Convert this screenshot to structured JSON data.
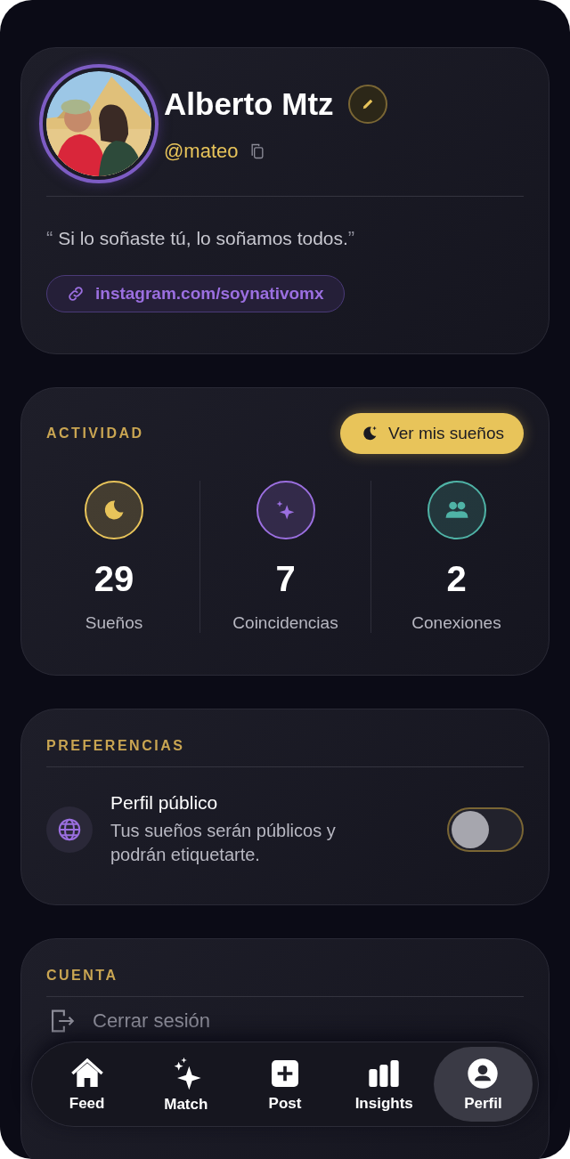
{
  "profile": {
    "name": "Alberto Mtz",
    "handle": "@mateo",
    "quote_open": "“",
    "quote": "Si lo soñaste tú, lo soñamos todos.",
    "quote_close": "”",
    "link": "instagram.com/soynativomx"
  },
  "activity": {
    "title": "ACTIVIDAD",
    "button": "Ver mis sueños",
    "stats": [
      {
        "kind": "moon",
        "value": "29",
        "label": "Sueños",
        "color": "#e8c45a"
      },
      {
        "kind": "sparkles",
        "value": "7",
        "label": "Coincidencias",
        "color": "#9b6fe0"
      },
      {
        "kind": "people",
        "value": "2",
        "label": "Conexiones",
        "color": "#4fb3a6"
      }
    ]
  },
  "preferences": {
    "title": "PREFERENCIAS",
    "items": [
      {
        "title": "Perfil público",
        "description": "Tus sueños serán públicos y podrán etiquetarte.",
        "on": false
      }
    ]
  },
  "account": {
    "title": "CUENTA",
    "items": [
      {
        "label": "Cerrar sesión"
      }
    ]
  },
  "tabs": [
    {
      "kind": "home",
      "label": "Feed",
      "selected": false
    },
    {
      "kind": "sparkles",
      "label": "Match",
      "selected": false
    },
    {
      "kind": "plus",
      "label": "Post",
      "selected": false
    },
    {
      "kind": "bars",
      "label": "Insights",
      "selected": false
    },
    {
      "kind": "person",
      "label": "Perfil",
      "selected": true
    }
  ]
}
